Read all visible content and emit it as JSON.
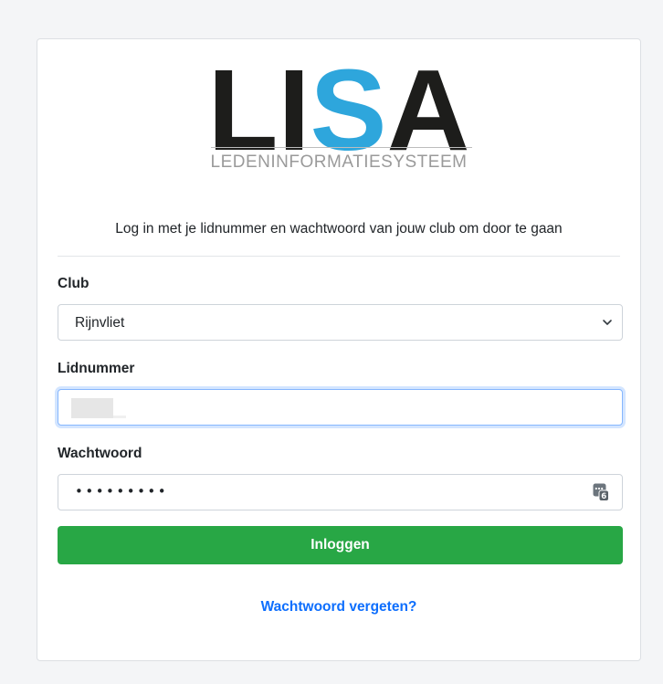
{
  "logo": {
    "part1": "LI",
    "part2": "S",
    "part3": "A",
    "subtitle": "LEDENINFORMATIESYSTEEM",
    "dark_color": "#1d1d1b",
    "accent_color": "#2ea6dc"
  },
  "intro_text": "Log in met je lidnummer en wachtwoord van jouw club om door te gaan",
  "form": {
    "club_label": "Club",
    "club_value": "Rijnvliet",
    "member_label": "Lidnummer",
    "member_value": "",
    "password_label": "Wachtwoord",
    "password_masked": "•••••••••",
    "login_button": "Inloggen",
    "forgot_link": "Wachtwoord vergeten?"
  },
  "icons": {
    "select": "chevron-down-icon",
    "password_manager": "password-key-icon"
  },
  "colors": {
    "button_bg": "#28a745",
    "link": "#0d6efd",
    "focus_border": "#86b7fe"
  }
}
